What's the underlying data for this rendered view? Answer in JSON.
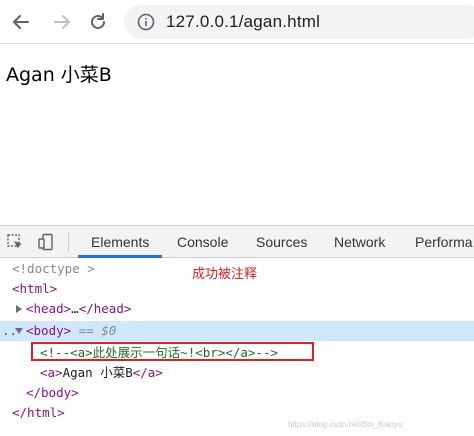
{
  "browser": {
    "url": "127.0.0.1/agan.html",
    "icons": {
      "back": "back-arrow-icon",
      "forward": "forward-arrow-icon",
      "reload": "reload-icon",
      "info": "info-icon"
    }
  },
  "page": {
    "body_text": "Agan 小菜B"
  },
  "devtools": {
    "tabs": [
      {
        "label": "Elements",
        "active": true
      },
      {
        "label": "Console",
        "active": false
      },
      {
        "label": "Sources",
        "active": false
      },
      {
        "label": "Network",
        "active": false
      },
      {
        "label": "Performa",
        "active": false
      }
    ],
    "icons": {
      "inspect": "inspect-element-icon",
      "device": "device-toolbar-icon"
    },
    "dom": {
      "doctype": "<!doctype >",
      "html_open": "<html>",
      "head_open": "<head>",
      "head_ellipsis": "…",
      "head_close": "</head>",
      "body_open": "<body>",
      "body_marker": "== $0",
      "row_dots": "..",
      "comment": "<!--<a>此处展示一句话~!<br></a>-->",
      "a_open": "<a>",
      "a_text": "Agan 小菜B",
      "a_close": "</a>",
      "body_close": "</body>",
      "html_close": "</html>"
    }
  },
  "annotation": {
    "label": "成功被注释",
    "color": "#e02020"
  },
  "watermark": "https://blog.csdn.net/Bin_Xiaoyu"
}
